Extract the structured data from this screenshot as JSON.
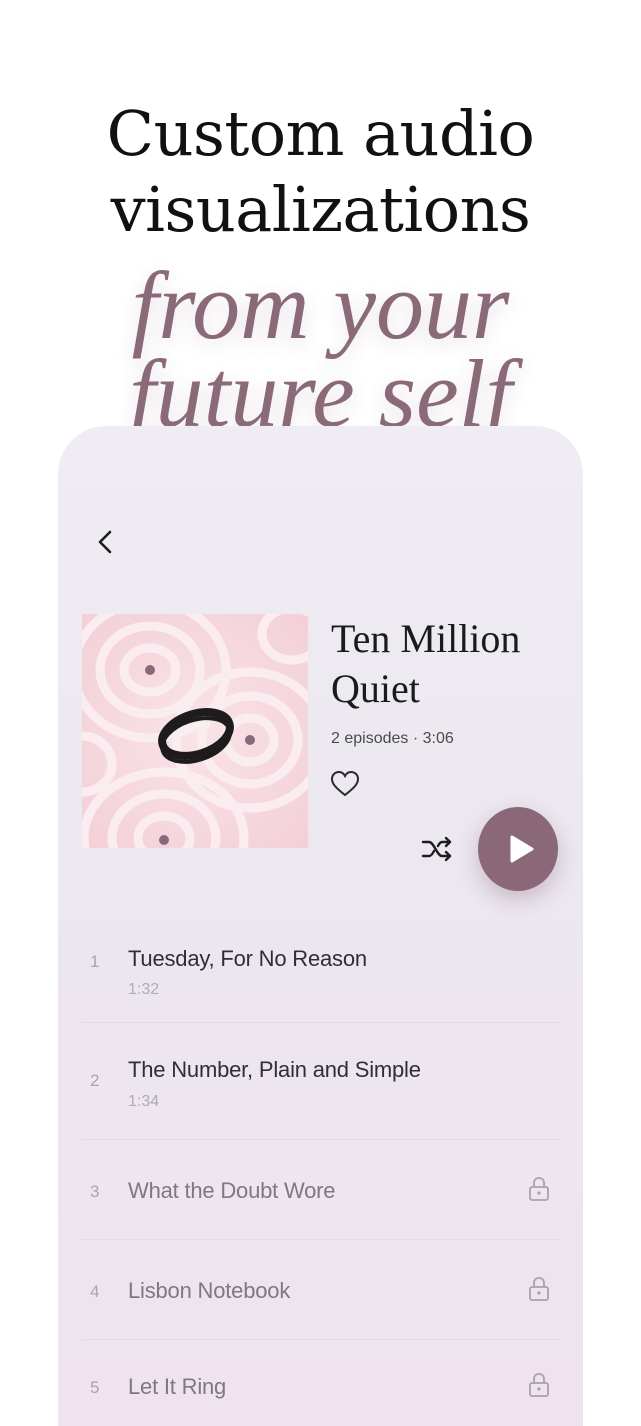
{
  "headline": {
    "line1": "Custom audio",
    "line2": "visualizations",
    "subline1": "from your",
    "subline2": "future self"
  },
  "album": {
    "title_line1": "Ten Million",
    "title_line2": "Quiet",
    "meta": "2 episodes · 3:06"
  },
  "icons": {
    "back": "chevron-left-icon",
    "favorite": "heart-icon",
    "shuffle": "shuffle-icon",
    "play": "play-icon",
    "lock": "lock-icon"
  },
  "colors": {
    "accent": "#8a6878",
    "subline": "#8a6978",
    "cover_bg": "#f6d8de"
  },
  "tracks": [
    {
      "number": "1",
      "name": "Tuesday, For No Reason",
      "duration": "1:32",
      "locked": false
    },
    {
      "number": "2",
      "name": "The Number, Plain and Simple",
      "duration": "1:34",
      "locked": false
    },
    {
      "number": "3",
      "name": "What the Doubt Wore",
      "duration": "",
      "locked": true
    },
    {
      "number": "4",
      "name": "Lisbon Notebook",
      "duration": "",
      "locked": true
    },
    {
      "number": "5",
      "name": "Let It Ring",
      "duration": "",
      "locked": true
    }
  ]
}
